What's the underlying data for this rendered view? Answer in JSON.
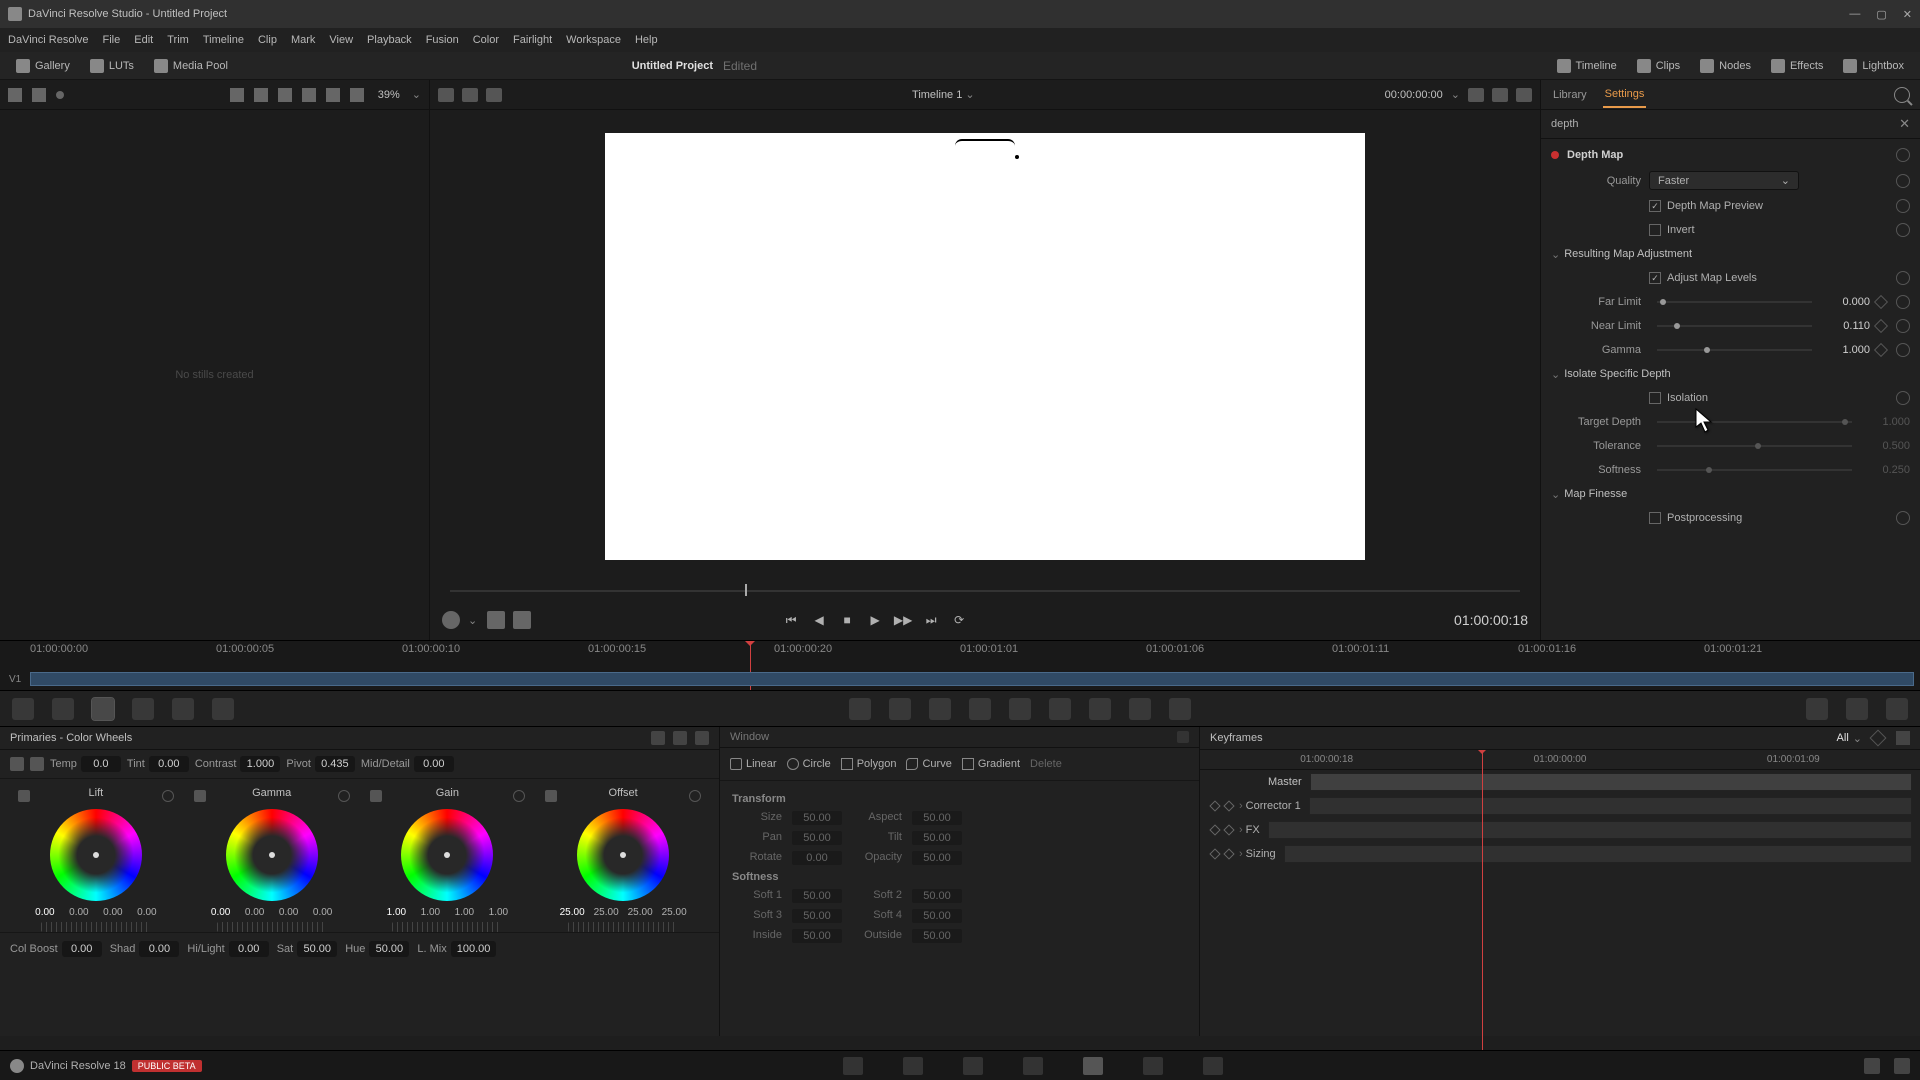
{
  "titlebar": {
    "app": "DaVinci Resolve Studio - Untitled Project"
  },
  "menubar": [
    "DaVinci Resolve",
    "File",
    "Edit",
    "Trim",
    "Timeline",
    "Clip",
    "Mark",
    "View",
    "Playback",
    "Fusion",
    "Color",
    "Fairlight",
    "Workspace",
    "Help"
  ],
  "toolbar": {
    "left": [
      {
        "icon": "gallery-icon",
        "label": "Gallery"
      },
      {
        "icon": "luts-icon",
        "label": "LUTs"
      },
      {
        "icon": "media-pool-icon",
        "label": "Media Pool"
      }
    ],
    "center_title": "Untitled Project",
    "edited": "Edited",
    "right": [
      {
        "icon": "timeline-icon",
        "label": "Timeline"
      },
      {
        "icon": "clips-icon",
        "label": "Clips"
      },
      {
        "icon": "nodes-icon",
        "label": "Nodes"
      },
      {
        "icon": "effects-icon",
        "label": "Effects"
      },
      {
        "icon": "lightbox-icon",
        "label": "Lightbox"
      }
    ]
  },
  "gallery": {
    "zoom": "39%",
    "timeline_dropdown": "Timeline 1",
    "timecode": "00:00:00:00",
    "empty": "No stills created"
  },
  "viewer": {
    "timecode": "01:00:00:18"
  },
  "inspector_tabs": {
    "library": "Library",
    "settings": "Settings"
  },
  "search": "depth",
  "depthmap": {
    "title": "Depth Map",
    "quality_label": "Quality",
    "quality_value": "Faster",
    "preview": "Depth Map Preview",
    "invert": "Invert",
    "resulting": "Resulting Map Adjustment",
    "adjust_levels": "Adjust Map Levels",
    "far_limit_label": "Far Limit",
    "far_limit_value": "0.000",
    "near_limit_label": "Near Limit",
    "near_limit_value": "0.110",
    "gamma_label": "Gamma",
    "gamma_value": "1.000",
    "isolate": "Isolate Specific Depth",
    "isolation": "Isolation",
    "target_depth_label": "Target Depth",
    "target_depth_value": "1.000",
    "tolerance_label": "Tolerance",
    "tolerance_value": "0.500",
    "softness_label": "Softness",
    "softness_value": "0.250",
    "finesse": "Map Finesse",
    "postprocessing": "Postprocessing"
  },
  "ruler_labels": [
    "01:00:00:00",
    "01:00:00:05",
    "01:00:00:10",
    "01:00:00:15",
    "01:00:00:20",
    "01:00:01:01",
    "01:00:01:06",
    "01:00:01:11",
    "01:00:01:16",
    "01:00:01:21"
  ],
  "track_v1": "V1",
  "wheels": {
    "title": "Primaries - Color Wheels",
    "top_adj": [
      {
        "label": "Temp",
        "value": "0.0"
      },
      {
        "label": "Tint",
        "value": "0.00"
      },
      {
        "label": "Contrast",
        "value": "1.000"
      },
      {
        "label": "Pivot",
        "value": "0.435"
      },
      {
        "label": "Mid/Detail",
        "value": "0.00"
      }
    ],
    "cells": [
      {
        "name": "Lift",
        "vals": [
          "0.00",
          "0.00",
          "0.00",
          "0.00"
        ]
      },
      {
        "name": "Gamma",
        "vals": [
          "0.00",
          "0.00",
          "0.00",
          "0.00"
        ]
      },
      {
        "name": "Gain",
        "vals": [
          "1.00",
          "1.00",
          "1.00",
          "1.00"
        ]
      },
      {
        "name": "Offset",
        "vals": [
          "25.00",
          "25.00",
          "25.00",
          "25.00"
        ]
      }
    ],
    "bot_adj": [
      {
        "label": "Col Boost",
        "value": "0.00"
      },
      {
        "label": "Shad",
        "value": "0.00"
      },
      {
        "label": "Hi/Light",
        "value": "0.00"
      },
      {
        "label": "Sat",
        "value": "50.00"
      },
      {
        "label": "Hue",
        "value": "50.00"
      },
      {
        "label": "L. Mix",
        "value": "100.00"
      }
    ]
  },
  "window_panel": {
    "title": "Window",
    "shapes": [
      "Linear",
      "Circle",
      "Polygon",
      "Curve",
      "Gradient"
    ],
    "delete": "Delete"
  },
  "transform": {
    "title": "Transform",
    "rows": [
      {
        "l1": "Size",
        "v1": "50.00",
        "l2": "Aspect",
        "v2": "50.00"
      },
      {
        "l1": "Pan",
        "v1": "50.00",
        "l2": "Tilt",
        "v2": "50.00"
      },
      {
        "l1": "Rotate",
        "v1": "0.00",
        "l2": "Opacity",
        "v2": "50.00"
      }
    ],
    "softness_title": "Softness",
    "soft_rows": [
      {
        "l1": "Soft 1",
        "v1": "50.00",
        "l2": "Soft 2",
        "v2": "50.00"
      },
      {
        "l1": "Soft 3",
        "v1": "50.00",
        "l2": "Soft 4",
        "v2": "50.00"
      },
      {
        "l1": "Inside",
        "v1": "50.00",
        "l2": "Outside",
        "v2": "50.00"
      }
    ]
  },
  "keyframes": {
    "title": "Keyframes",
    "all": "All",
    "ruler": [
      "01:00:00:18",
      "01:00:00:00",
      "01:00:01:09"
    ],
    "rows": [
      "Master",
      "Corrector 1",
      "FX",
      "Sizing"
    ]
  },
  "footer": {
    "app": "DaVinci Resolve 18",
    "beta": "PUBLIC BETA"
  }
}
